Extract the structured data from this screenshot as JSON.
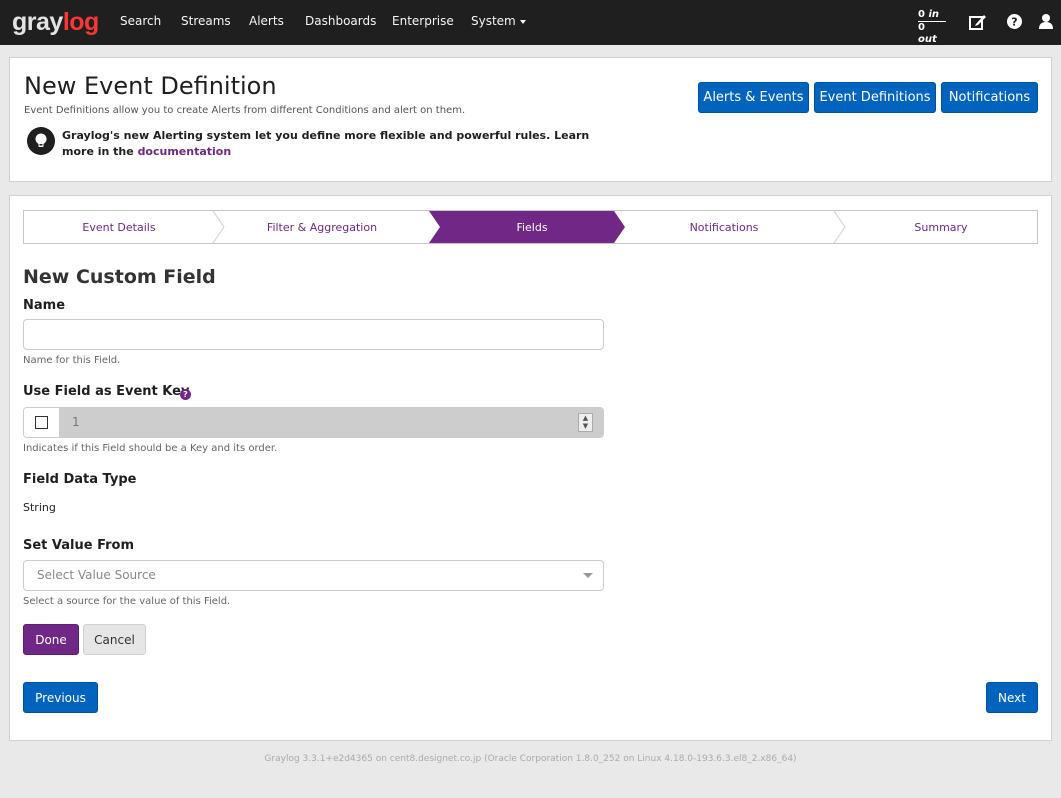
{
  "brand": {
    "part1": "gray",
    "part2": "log"
  },
  "nav": {
    "items": [
      {
        "label": "Search"
      },
      {
        "label": "Streams"
      },
      {
        "label": "Alerts"
      },
      {
        "label": "Dashboards"
      },
      {
        "label": "Enterprise"
      },
      {
        "label": "System"
      }
    ],
    "throughput": {
      "in_value": "0",
      "in_label": "in",
      "out_value": "0",
      "out_label": "out"
    },
    "icons": [
      "edit-icon",
      "help-icon",
      "user-icon"
    ]
  },
  "header": {
    "title": "New Event Definition",
    "description": "Event Definitions allow you to create Alerts from different Conditions and alert on them.",
    "info_text": "Graylog's new Alerting system let you define more flexible and powerful rules. Learn more in the",
    "info_link": "documentation",
    "buttons": [
      {
        "label": "Alerts & Events"
      },
      {
        "label": "Event Definitions"
      },
      {
        "label": "Notifications"
      }
    ]
  },
  "wizard": {
    "steps": [
      {
        "label": "Event Details",
        "active": false
      },
      {
        "label": "Filter & Aggregation",
        "active": false
      },
      {
        "label": "Fields",
        "active": true
      },
      {
        "label": "Notifications",
        "active": false
      },
      {
        "label": "Summary",
        "active": false
      }
    ],
    "active_color": "#702785"
  },
  "form": {
    "section_title": "New Custom Field",
    "name": {
      "label": "Name",
      "value": "",
      "help": "Name for this Field."
    },
    "event_key": {
      "label": "Use Field as Event Key",
      "checked": false,
      "order": "1",
      "help": "Indicates if this Field should be a Key and its order."
    },
    "data_type": {
      "label": "Field Data Type",
      "value": "String"
    },
    "value_from": {
      "label": "Set Value From",
      "placeholder": "Select Value Source",
      "help": "Select a source for the value of this Field."
    },
    "done_label": "Done",
    "cancel_label": "Cancel"
  },
  "navigation": {
    "previous_label": "Previous",
    "next_label": "Next"
  },
  "footer": {
    "text": "Graylog 3.3.1+e2d4365 on cent8.designet.co.jp (Oracle Corporation 1.8.0_252 on Linux 4.18.0-193.6.3.el8_2.x86_64)"
  },
  "colors": {
    "navbar": "#1f1f1f",
    "primary": "#0063be",
    "accent": "#702785",
    "brand_red": "#ff3633"
  }
}
